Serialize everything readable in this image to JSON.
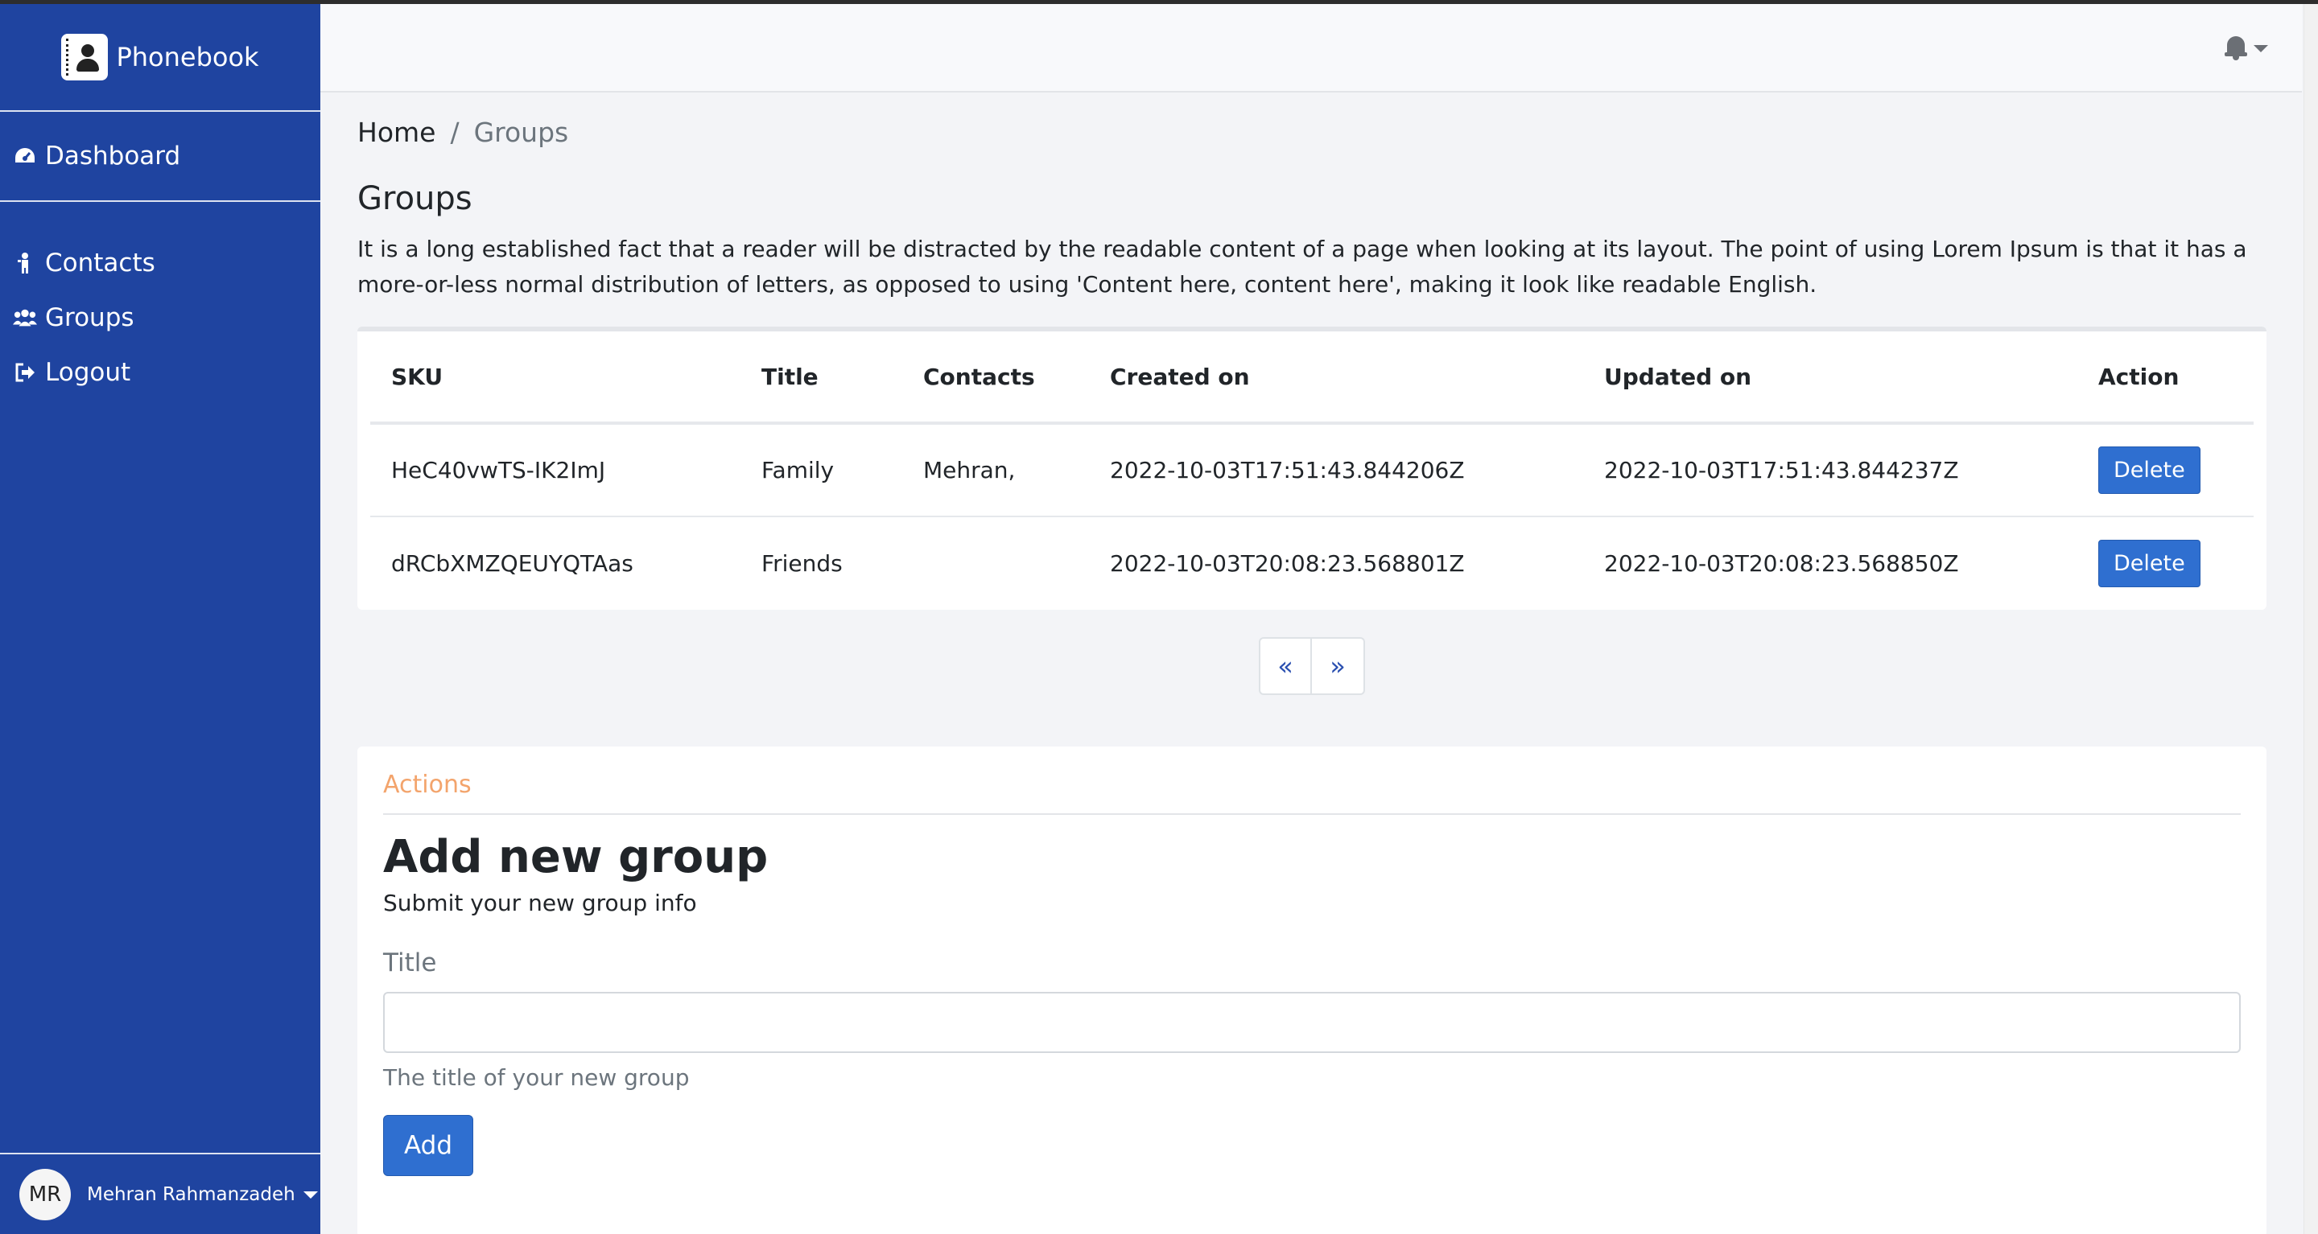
{
  "app": {
    "brand": "Phonebook"
  },
  "sidebar": {
    "dashboard": {
      "label": "Dashboard",
      "icon": "dashboard-icon"
    },
    "items": [
      {
        "label": "Contacts",
        "icon": "person-icon"
      },
      {
        "label": "Groups",
        "icon": "users-icon"
      },
      {
        "label": "Logout",
        "icon": "logout-icon"
      }
    ],
    "user": {
      "initials": "MR",
      "name": "Mehran Rahmanzadeh"
    }
  },
  "breadcrumb": {
    "home": "Home",
    "separator": "/",
    "current": "Groups"
  },
  "page": {
    "title": "Groups",
    "description": "It is a long established fact that a reader will be distracted by the readable content of a page when looking at its layout. The point of using Lorem Ipsum is that it has a more-or-less normal distribution of letters, as opposed to using 'Content here, content here', making it look like readable English."
  },
  "table": {
    "columns": [
      "SKU",
      "Title",
      "Contacts",
      "Created on",
      "Updated on",
      "Action"
    ],
    "rows": [
      {
        "sku": "HeC40vwTS-IK2ImJ",
        "title": "Family",
        "contacts": "Mehran,",
        "created": "2022-10-03T17:51:43.844206Z",
        "updated": "2022-10-03T17:51:43.844237Z",
        "action": "Delete"
      },
      {
        "sku": "dRCbXMZQEUYQTAas",
        "title": "Friends",
        "contacts": "",
        "created": "2022-10-03T20:08:23.568801Z",
        "updated": "2022-10-03T20:08:23.568850Z",
        "action": "Delete"
      }
    ]
  },
  "pagination": {
    "prev": "«",
    "next": "»"
  },
  "actions": {
    "heading": "Actions",
    "form_title": "Add new group",
    "form_subtitle": "Submit your new group info",
    "title_label": "Title",
    "title_value": "",
    "title_help": "The title of your new group",
    "submit_label": "Add"
  },
  "colors": {
    "sidebar": "#1f44a0",
    "primary": "#2f6fd0",
    "actions_heading": "#f3a46c"
  }
}
